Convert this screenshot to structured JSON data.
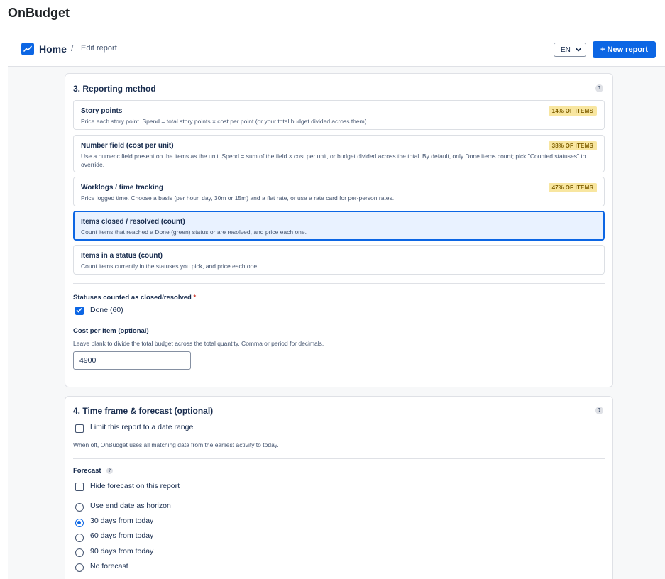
{
  "app": {
    "title": "OnBudget"
  },
  "breadcrumb": {
    "home": "Home",
    "separator": "/",
    "current": "Edit report"
  },
  "header": {
    "language": "EN",
    "new_report": "+ New report"
  },
  "section3": {
    "title": "3. Reporting method",
    "help": "?",
    "options": [
      {
        "title": "Story points",
        "desc": "Price each story point. Spend = total story points × cost per point (or your total budget divided across them).",
        "badge": "14% OF ITEMS"
      },
      {
        "title": "Number field (cost per unit)",
        "desc": "Use a numeric field present on the items as the unit. Spend = sum of the field × cost per unit, or budget divided across the total. By default, only Done items count; pick \"Counted statuses\" to override.",
        "badge": "38% OF ITEMS"
      },
      {
        "title": "Worklogs / time tracking",
        "desc": "Price logged time. Choose a basis (per hour, day, 30m or 15m) and a flat rate, or use a rate card for per-person rates.",
        "badge": "47% OF ITEMS"
      },
      {
        "title": "Items closed / resolved (count)",
        "desc": "Count items that reached a Done (green) status or are resolved, and price each one.",
        "badge": ""
      },
      {
        "title": "Items in a status (count)",
        "desc": "Count items currently in the statuses you pick, and price each one.",
        "badge": ""
      }
    ],
    "selected_index": 3,
    "statuses_label": "Statuses counted as closed/resolved",
    "required_mark": "*",
    "done_label": "Done (60)",
    "done_checked": true,
    "cost_label": "Cost per item (optional)",
    "cost_helper": "Leave blank to divide the total budget across the total quantity. Comma or period for decimals.",
    "cost_value": "4900"
  },
  "section4": {
    "title": "4. Time frame & forecast (optional)",
    "help": "?",
    "limit_label": "Limit this report to a date range",
    "limit_checked": false,
    "limit_helper": "When off, OnBudget uses all matching data from the earliest activity to today.",
    "forecast_label": "Forecast",
    "forecast_help": "?",
    "hide_forecast_label": "Hide forecast on this report",
    "hide_forecast_checked": false,
    "horizons": [
      {
        "label": "Use end date as horizon",
        "checked": false
      },
      {
        "label": "30 days from today",
        "checked": true
      },
      {
        "label": "60 days from today",
        "checked": false
      },
      {
        "label": "90 days from today",
        "checked": false
      },
      {
        "label": "No forecast",
        "checked": false
      }
    ]
  },
  "colors": {
    "accent": "#0c66e4",
    "badge_bg": "#f8e6a0",
    "badge_text": "#7f5f01",
    "selected_bg": "#e9f2ff"
  }
}
